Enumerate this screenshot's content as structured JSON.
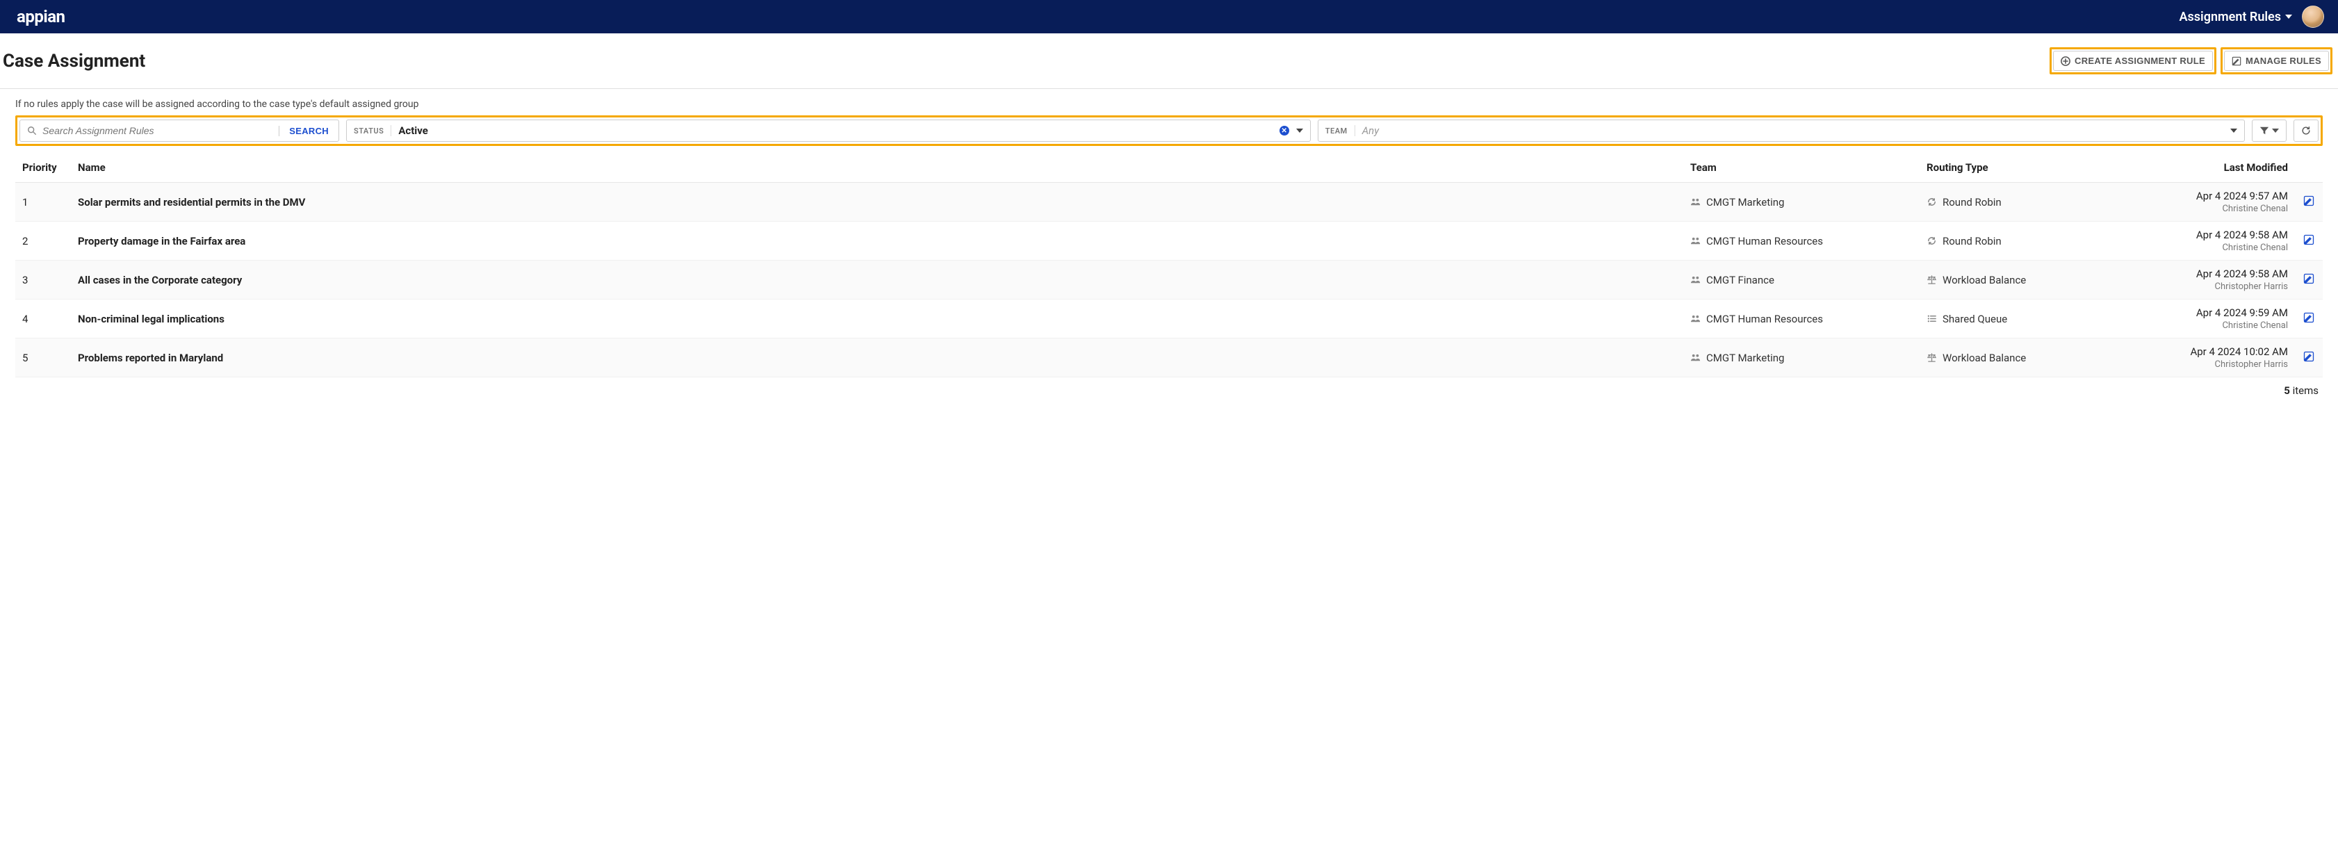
{
  "nav": {
    "logo_text": "appian",
    "menu_label": "Assignment Rules"
  },
  "header": {
    "title": "Case Assignment",
    "create_rule_label": "CREATE ASSIGNMENT RULE",
    "manage_rules_label": "MANAGE RULES"
  },
  "hint": "If no rules apply the case will be assigned according to the case type's default assigned group",
  "filters": {
    "search_placeholder": "Search Assignment Rules",
    "search_button": "SEARCH",
    "status_label": "STATUS",
    "status_value": "Active",
    "team_label": "TEAM",
    "team_placeholder": "Any"
  },
  "columns": {
    "priority": "Priority",
    "name": "Name",
    "team": "Team",
    "routing": "Routing Type",
    "lastmod": "Last Modified"
  },
  "rows": [
    {
      "priority": "1",
      "name": "Solar permits and residential permits in the DMV",
      "team": "CMGT Marketing",
      "routing_icon": "refresh",
      "routing": "Round Robin",
      "lastmod_date": "Apr 4 2024 9:57 AM",
      "lastmod_user": "Christine Chenal"
    },
    {
      "priority": "2",
      "name": "Property damage in the Fairfax area",
      "team": "CMGT Human Resources",
      "routing_icon": "refresh",
      "routing": "Round Robin",
      "lastmod_date": "Apr 4 2024 9:58 AM",
      "lastmod_user": "Christine Chenal"
    },
    {
      "priority": "3",
      "name": "All cases in the Corporate category",
      "team": "CMGT Finance",
      "routing_icon": "balance",
      "routing": "Workload Balance",
      "lastmod_date": "Apr 4 2024 9:58 AM",
      "lastmod_user": "Christopher Harris"
    },
    {
      "priority": "4",
      "name": "Non-criminal legal implications",
      "team": "CMGT Human Resources",
      "routing_icon": "list",
      "routing": "Shared Queue",
      "lastmod_date": "Apr 4 2024 9:59 AM",
      "lastmod_user": "Christine Chenal"
    },
    {
      "priority": "5",
      "name": "Problems reported in Maryland",
      "team": "CMGT Marketing",
      "routing_icon": "balance",
      "routing": "Workload Balance",
      "lastmod_date": "Apr 4 2024 10:02 AM",
      "lastmod_user": "Christopher Harris"
    }
  ],
  "footer": {
    "count": "5",
    "items_label": "items"
  }
}
